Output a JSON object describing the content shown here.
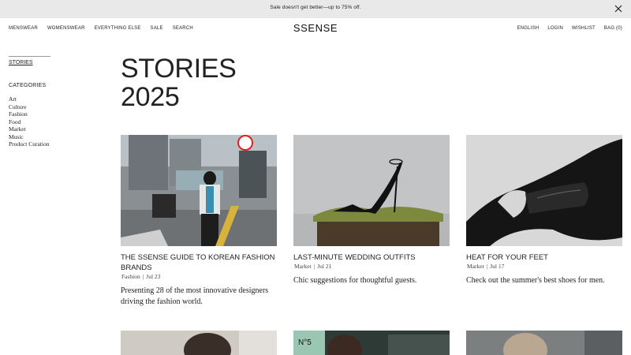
{
  "promo": {
    "text": "Sale doesn't get better—up to 75% off.",
    "close_icon": "close-icon"
  },
  "header": {
    "logo": "SSENSE",
    "nav_left": [
      "MENSWEAR",
      "WOMENSWEAR",
      "EVERYTHING ELSE",
      "SALE",
      "SEARCH"
    ],
    "nav_right": [
      "ENGLISH",
      "LOGIN",
      "WISHLIST",
      "BAG (0)"
    ]
  },
  "sidebar": {
    "current": "STORIES",
    "categories_heading": "CATEGORIES",
    "categories": [
      "Art",
      "Culture",
      "Fashion",
      "Food",
      "Market",
      "Music",
      "Product Curation"
    ]
  },
  "page": {
    "title_line1": "STORIES",
    "title_line2": "2025"
  },
  "cards": [
    {
      "title": "THE SSENSE GUIDE TO KOREAN FASHION BRANDS",
      "category": "Fashion",
      "date": "Jul 23",
      "description": "Presenting 28 of the most innovative designers driving the fashion world."
    },
    {
      "title": "LAST-MINUTE WEDDING OUTFITS",
      "category": "Market",
      "date": "Jul 21",
      "description": "Chic suggestions for thoughtful guests."
    },
    {
      "title": "HEAT FOR YOUR FEET",
      "category": "Market",
      "date": "Jul 17",
      "description": "Check out the summer's best shoes for men."
    }
  ],
  "colors": {
    "banner_bg": "#e9e9e9",
    "text": "#222222",
    "background": "#ffffff"
  }
}
